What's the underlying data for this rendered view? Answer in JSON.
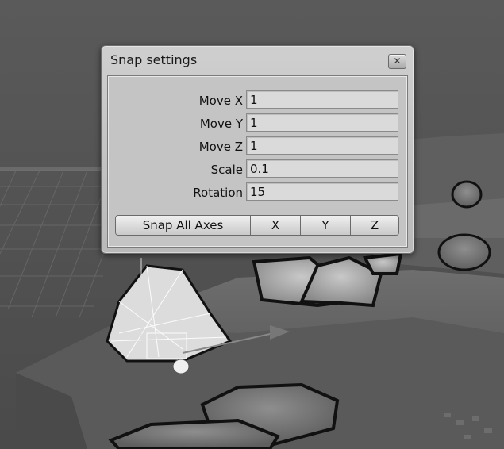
{
  "dialog": {
    "title": "Snap settings",
    "close_symbol": "✕",
    "fields": [
      {
        "label": "Move X",
        "value": "1"
      },
      {
        "label": "Move Y",
        "value": "1"
      },
      {
        "label": "Move Z",
        "value": "1"
      },
      {
        "label": "Scale",
        "value": "0.1"
      },
      {
        "label": "Rotation",
        "value": "15"
      }
    ],
    "buttons": {
      "snap_all": "Snap All Axes",
      "x": "X",
      "y": "Y",
      "z": "Z"
    }
  },
  "icons": {
    "close": "close-icon"
  }
}
